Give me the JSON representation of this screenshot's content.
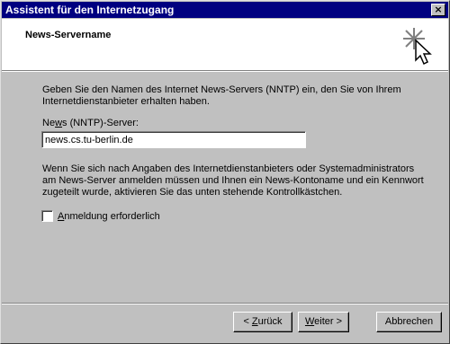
{
  "window": {
    "title": "Assistent für den Internetzugang",
    "close_glyph": "×"
  },
  "header": {
    "heading": "News-Servername",
    "icon": "wizard-sparkle-cursor-icon"
  },
  "intro_text": "Geben Sie den Namen des Internet News-Servers (NNTP) ein, den Sie von Ihrem Internetdienstanbieter erhalten haben.",
  "server": {
    "label_pre": "Ne",
    "label_key": "w",
    "label_post": "s (NNTP)-Server:",
    "value": "news.cs.tu-berlin.de"
  },
  "info_text": "Wenn Sie sich nach Angaben des Internetdienstanbieters oder Systemadministrators am News-Server anmelden müssen und Ihnen ein News-Kontoname und ein Kennwort zugeteilt wurde, aktivieren Sie das unten stehende Kontrollkästchen.",
  "login_checkbox": {
    "label_key": "A",
    "label_rest": "nmeldung erforderlich",
    "checked": false
  },
  "buttons": {
    "back_pre": "< ",
    "back_key": "Z",
    "back_post": "urück",
    "next_key": "W",
    "next_post": "eiter >",
    "cancel": "Abbrechen"
  }
}
